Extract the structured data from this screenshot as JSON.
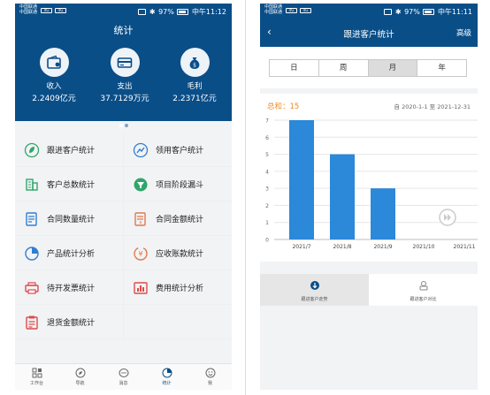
{
  "left": {
    "status": {
      "carrier1": "中国联通",
      "carrier2": "中国联通",
      "sig1": "4G",
      "sig2": "4G",
      "battery": "97%",
      "time": "中午11:12"
    },
    "title": "统计",
    "metrics": [
      {
        "label": "收入",
        "value": "2.2409亿元",
        "icon": "wallet-icon"
      },
      {
        "label": "支出",
        "value": "37.7129万元",
        "icon": "card-icon"
      },
      {
        "label": "毛利",
        "value": "2.2371亿元",
        "icon": "money-bag-icon"
      }
    ],
    "grid": [
      {
        "label": "跟进客户统计",
        "icon": "leaf-icon",
        "color": "#2fa66a"
      },
      {
        "label": "领用客户统计",
        "icon": "chart-person-icon",
        "color": "#2f7fd0"
      },
      {
        "label": "客户总数统计",
        "icon": "building-icon",
        "color": "#2fa66a"
      },
      {
        "label": "项目阶段漏斗",
        "icon": "funnel-icon",
        "color": "#2fa66a"
      },
      {
        "label": "合同数量统计",
        "icon": "document-icon",
        "color": "#2f7fd0"
      },
      {
        "label": "合同金额统计",
        "icon": "contract-amount-icon",
        "color": "#e07a4a"
      },
      {
        "label": "产品统计分析",
        "icon": "pie-icon",
        "color": "#2f7fd0"
      },
      {
        "label": "应收账款统计",
        "icon": "yen-coin-icon",
        "color": "#e07a4a"
      },
      {
        "label": "待开发票统计",
        "icon": "printer-icon",
        "color": "#e04a4a"
      },
      {
        "label": "费用统计分析",
        "icon": "expense-chart-icon",
        "color": "#e04a4a"
      },
      {
        "label": "退货金额统计",
        "icon": "clipboard-icon",
        "color": "#e04a4a"
      }
    ],
    "tabs": [
      {
        "label": "工作台",
        "icon": "workbench-icon"
      },
      {
        "label": "导航",
        "icon": "compass-icon"
      },
      {
        "label": "消息",
        "icon": "message-icon"
      },
      {
        "label": "统计",
        "icon": "stats-icon",
        "active": true
      },
      {
        "label": "我",
        "icon": "me-icon"
      }
    ]
  },
  "right": {
    "status": {
      "carrier1": "中国联通",
      "carrier2": "中国联通",
      "sig1": "4G",
      "sig2": "4G",
      "battery": "97%",
      "time": "中午11:11"
    },
    "back": "‹",
    "title": "跟进客户统计",
    "advanced": "高级",
    "segments": [
      "日",
      "周",
      "月",
      "年"
    ],
    "selected_segment": "月",
    "sum_label": "总和：15",
    "date_range": "自 2020-1-1 至 2021-12-31",
    "bottom_tabs": [
      {
        "label": "跟进客户走势",
        "icon": "trend-icon"
      },
      {
        "label": "跟进客户对比",
        "icon": "compare-icon"
      }
    ]
  },
  "chart_data": {
    "type": "bar",
    "categories": [
      "2021/7",
      "2021/8",
      "2021/9",
      "2021/10",
      "2021/11"
    ],
    "values": [
      7,
      5,
      3,
      0,
      0
    ],
    "ylim": [
      0,
      7
    ],
    "yticks": [
      "0",
      "1",
      "2",
      "3",
      "4",
      "5",
      "6",
      "7"
    ],
    "grid": true,
    "bar_color": "#2c88d9"
  }
}
